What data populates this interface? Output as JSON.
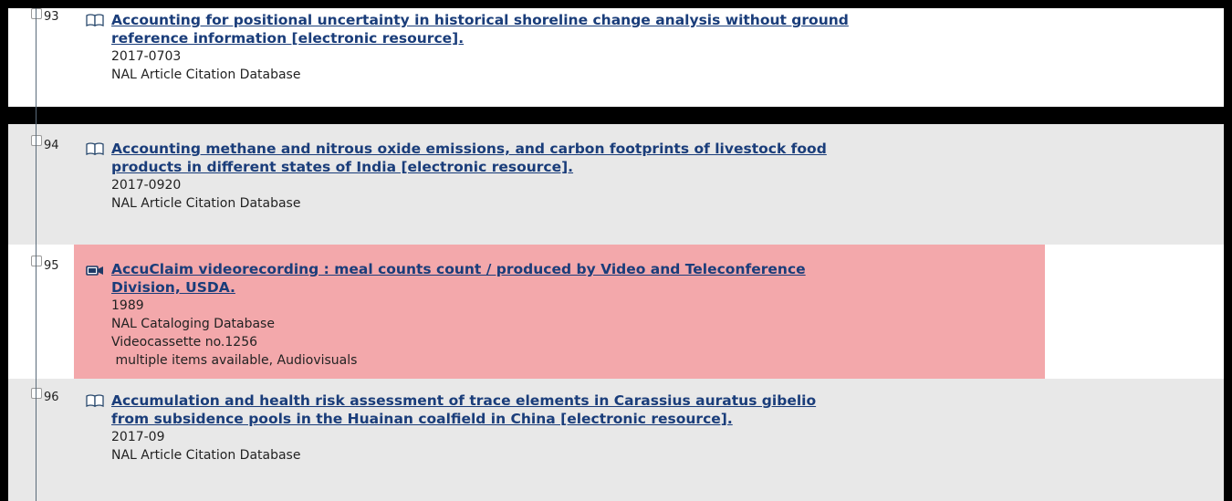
{
  "records": [
    {
      "number": "93",
      "icon": "book-icon",
      "title_line1": "Accounting for positional uncertainty in historical shoreline change analysis without ground",
      "title_line2": "reference information [electronic resource].",
      "date": "2017-0703",
      "source": "NAL Article Citation Database"
    },
    {
      "number": "94",
      "icon": "book-icon",
      "title_line1": "Accounting methane and nitrous oxide emissions, and carbon footprints of livestock food",
      "title_line2": "products in different states of India [electronic resource].",
      "date": "2017-0920",
      "source": "NAL Article Citation Database"
    },
    {
      "number": "95",
      "icon": "video-camera-icon",
      "title_line1": "AccuClaim videorecording : meal counts count / produced by Video and Teleconference",
      "title_line2": "Division, USDA.",
      "date": "1989",
      "source": "NAL Cataloging Database",
      "call_number": "Videocassette no.1256",
      "availability": " multiple items available, Audiovisuals"
    },
    {
      "number": "96",
      "icon": "book-icon",
      "title_line1": "Accumulation and health risk assessment of trace elements in Carassius auratus gibelio",
      "title_line2": "from subsidence pools in the Huainan coalfield in China [electronic resource].",
      "date": "2017-09",
      "source": "NAL Article Citation Database"
    }
  ],
  "colors": {
    "link": "#1a3d7a",
    "highlight": "#f3a8ab",
    "row_gray": "#e8e8e8"
  }
}
